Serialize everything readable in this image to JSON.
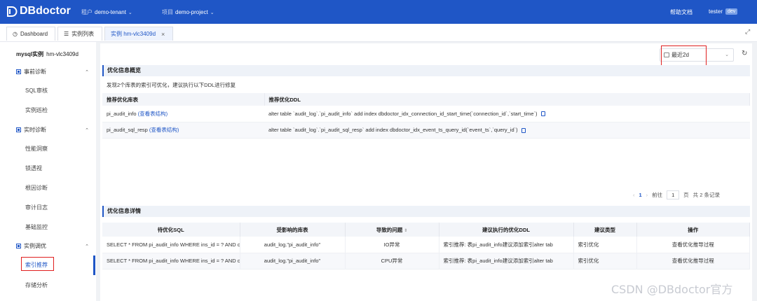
{
  "topbar": {
    "logo_text": "DBdoctor",
    "tenant_label": "租户",
    "tenant_value": "demo-tenant",
    "project_label": "项目",
    "project_value": "demo-project",
    "help": "帮助文档",
    "user": "tester",
    "env_badge": "dev"
  },
  "tabs": [
    {
      "label": "Dashboard"
    },
    {
      "label": "实例列表"
    },
    {
      "label": "实例 hm-vlc3409d"
    }
  ],
  "sidebar": {
    "instance_type": "mysql实例",
    "instance_id": "hm-vlc3409d",
    "groups": [
      {
        "label": "事前诊断",
        "items": [
          "SQL审核",
          "实例巡检"
        ]
      },
      {
        "label": "实时诊断",
        "items": [
          "性能洞察",
          "锁透视",
          "根因诊断",
          "审计日志",
          "基础监控"
        ]
      },
      {
        "label": "实例调优",
        "items": [
          "索引推荐",
          "存储分析"
        ]
      }
    ]
  },
  "main": {
    "date_range": "最近2d",
    "overview": {
      "title": "优化信息概览",
      "note": "发现2个库表的索引可优化，建议执行以下DDL进行修复",
      "columns": [
        "推荐优化库表",
        "推荐优化DDL"
      ],
      "rows": [
        {
          "table": "pi_audit_info",
          "link": "(查看表结构)",
          "ddl": "alter table `audit_log`.`pi_audit_info` add index dbdoctor_idx_connection_id_start_time(`connection_id`,`start_time`)"
        },
        {
          "table": "pi_audit_sql_resp",
          "link": "(查看表结构)",
          "ddl": "alter table `audit_log`.`pi_audit_sql_resp` add index dbdoctor_idx_event_ts_query_id(`event_ts`,`query_id`)"
        }
      ]
    },
    "pager": {
      "current": "1",
      "goto_label": "前往",
      "page_input": "1",
      "page_unit": "页",
      "total": "共 2 条记录"
    },
    "details": {
      "title": "优化信息详情",
      "columns": [
        "待优化SQL",
        "受影响的库表",
        "导致的问题",
        "建议执行的优化DDL",
        "建议类型",
        "操作"
      ],
      "rows": [
        {
          "sql": "SELECT * FROM pi_audit_info WHERE ins_id = ? AND cor",
          "table": "audit_log.\"pi_audit_info\"",
          "problem": "IO异常",
          "ddl": "索引推荐: 表pi_audit_info建议添加索引alter tab",
          "type": "索引优化",
          "action": "查看优化推导过程"
        },
        {
          "sql": "SELECT * FROM pi_audit_info WHERE ins_id = ? AND cor",
          "table": "audit_log.\"pi_audit_info\"",
          "problem": "CPU异常",
          "ddl": "索引推荐: 表pi_audit_info建议添加索引alter tab",
          "type": "索引优化",
          "action": "查看优化推导过程"
        }
      ]
    }
  },
  "watermark": "CSDN @DBdoctor官方"
}
